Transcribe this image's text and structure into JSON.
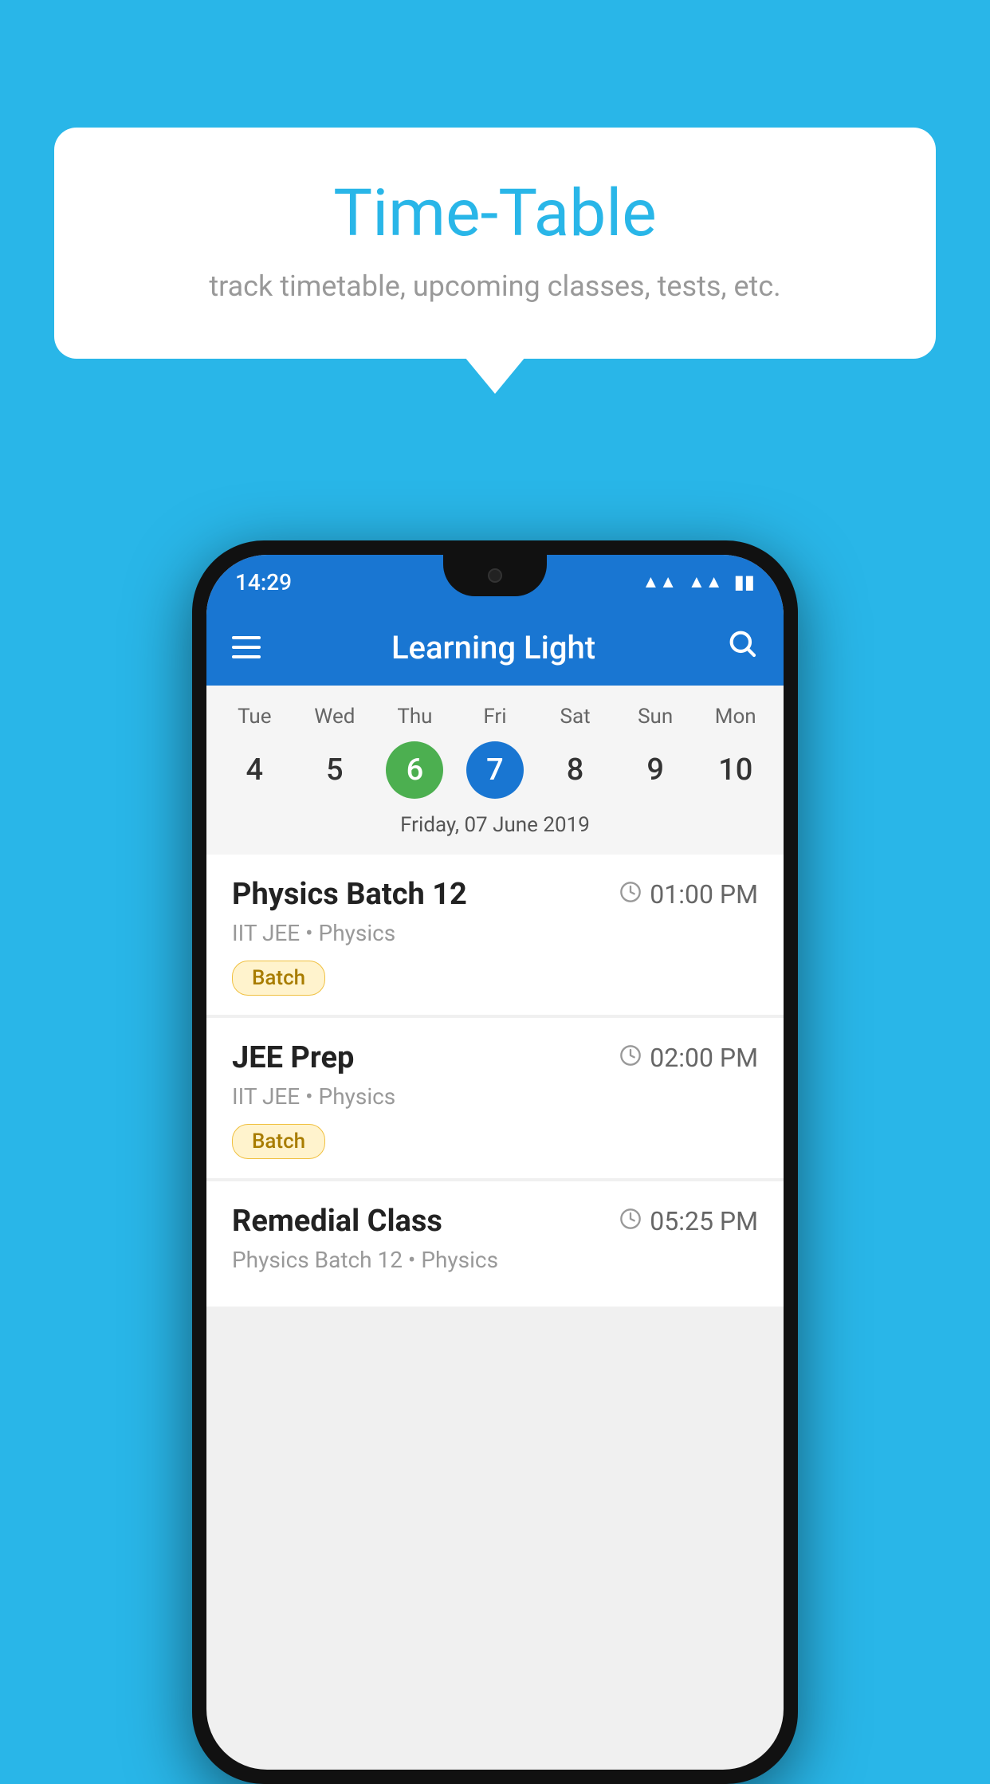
{
  "page": {
    "background_color": "#29b6e8"
  },
  "tooltip": {
    "title": "Time-Table",
    "subtitle": "track timetable, upcoming classes, tests, etc."
  },
  "status_bar": {
    "time": "14:29"
  },
  "app_bar": {
    "title": "Learning Light",
    "menu_icon": "hamburger-icon",
    "search_icon": "search-icon"
  },
  "calendar": {
    "days": [
      {
        "label": "Tue",
        "number": "4"
      },
      {
        "label": "Wed",
        "number": "5"
      },
      {
        "label": "Thu",
        "number": "6",
        "state": "today"
      },
      {
        "label": "Fri",
        "number": "7",
        "state": "selected"
      },
      {
        "label": "Sat",
        "number": "8"
      },
      {
        "label": "Sun",
        "number": "9"
      },
      {
        "label": "Mon",
        "number": "10"
      }
    ],
    "selected_date": "Friday, 07 June 2019"
  },
  "schedule": {
    "items": [
      {
        "title": "Physics Batch 12",
        "time": "01:00 PM",
        "subtitle": "IIT JEE • Physics",
        "badge": "Batch"
      },
      {
        "title": "JEE Prep",
        "time": "02:00 PM",
        "subtitle": "IIT JEE • Physics",
        "badge": "Batch"
      },
      {
        "title": "Remedial Class",
        "time": "05:25 PM",
        "subtitle": "Physics Batch 12 • Physics",
        "badge": ""
      }
    ]
  }
}
